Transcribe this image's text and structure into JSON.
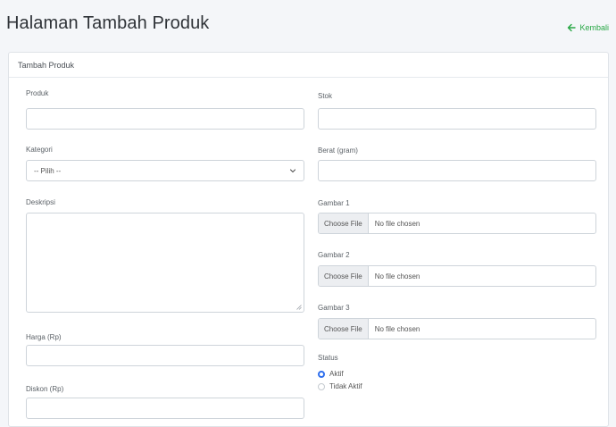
{
  "header": {
    "title": "Halaman Tambah Produk",
    "back_label": "Kembali"
  },
  "card": {
    "title": "Tambah Produk"
  },
  "form": {
    "produk": {
      "label": "Produk",
      "value": ""
    },
    "kategori": {
      "label": "Kategori",
      "selected": "-- Pilih --"
    },
    "deskripsi": {
      "label": "Deskripsi",
      "value": ""
    },
    "harga": {
      "label": "Harga (Rp)",
      "value": ""
    },
    "diskon": {
      "label": "Diskon (Rp)",
      "value": ""
    },
    "stok": {
      "label": "Stok",
      "value": ""
    },
    "berat": {
      "label": "Berat (gram)",
      "value": ""
    },
    "gambar1": {
      "label": "Gambar 1",
      "button": "Choose File",
      "status": "No file chosen"
    },
    "gambar2": {
      "label": "Gambar 2",
      "button": "Choose File",
      "status": "No file chosen"
    },
    "gambar3": {
      "label": "Gambar 3",
      "button": "Choose File",
      "status": "No file chosen"
    },
    "status": {
      "label": "Status",
      "options": [
        {
          "label": "Aktif",
          "checked": true
        },
        {
          "label": "Tidak Aktif",
          "checked": false
        }
      ]
    }
  },
  "colors": {
    "accent": "#2f6fed",
    "back_link": "#28a745",
    "background": "#f4f6f9"
  },
  "icons": {
    "back": "arrow-left-icon",
    "select": "chevron-down-icon"
  }
}
